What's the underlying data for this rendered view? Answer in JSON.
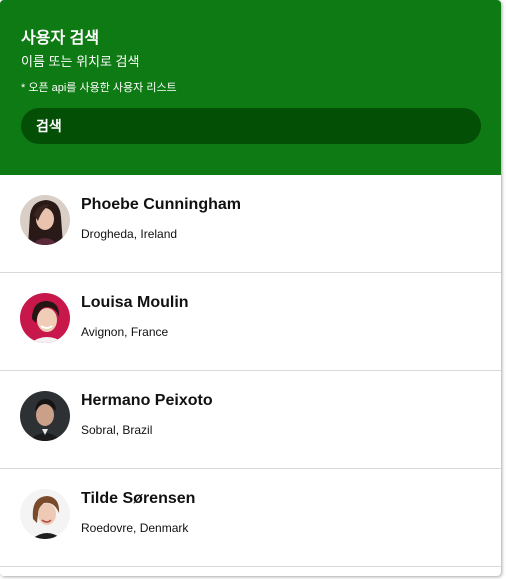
{
  "header": {
    "title": "사용자 검색",
    "subtitle": "이름 또는 위치로 검색",
    "note": "* 오픈 api를 사용한 사용자 리스트",
    "accent_color": "#0e7a13",
    "search_bg_color": "#044f06"
  },
  "search": {
    "placeholder": "검색"
  },
  "users": [
    {
      "name": "Phoebe Cunningham",
      "location": "Drogheda, Ireland",
      "avatar": "avatar-photo-woman-dark-hair"
    },
    {
      "name": "Louisa Moulin",
      "location": "Avignon, France",
      "avatar": "avatar-photo-woman-smiling-red-bg"
    },
    {
      "name": "Hermano Peixoto",
      "location": "Sobral, Brazil",
      "avatar": "avatar-photo-man-dark-bg"
    },
    {
      "name": "Tilde Sørensen",
      "location": "Roedovre, Denmark",
      "avatar": "avatar-photo-woman-light-bg"
    }
  ]
}
